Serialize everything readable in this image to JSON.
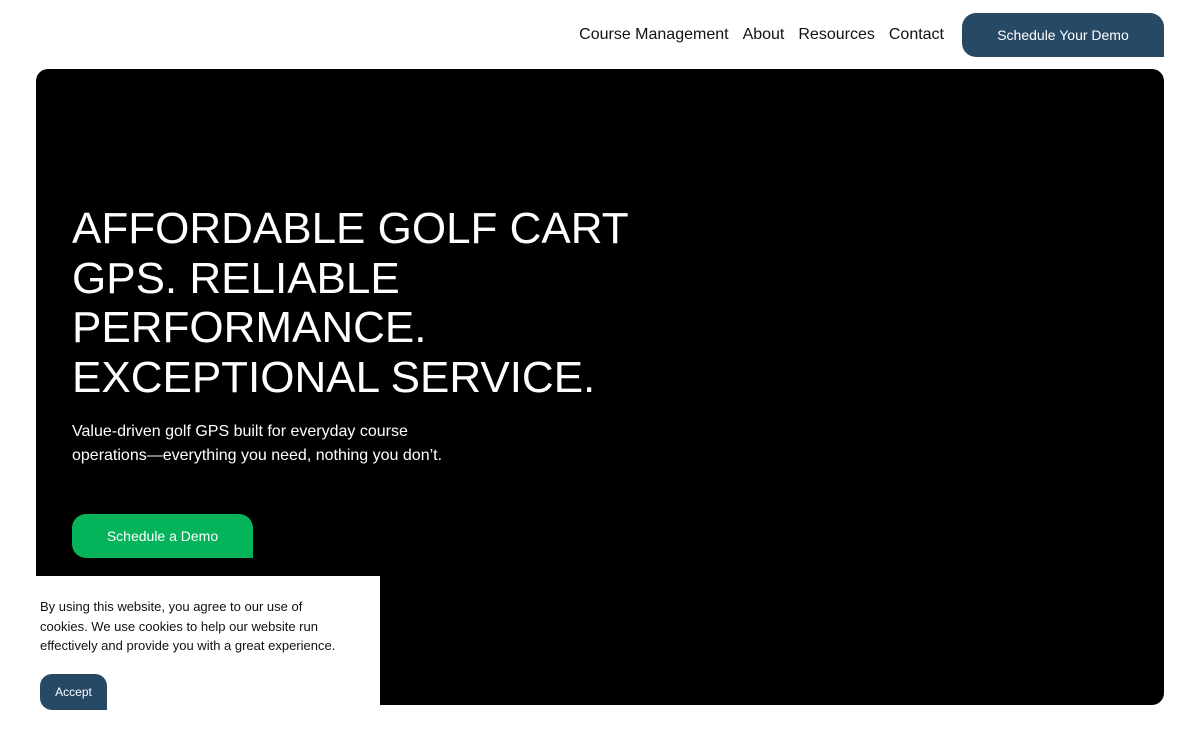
{
  "nav": {
    "links": [
      "Course Management",
      "About",
      "Resources",
      "Contact"
    ],
    "cta_label": "Schedule Your Demo"
  },
  "hero": {
    "title": "AFFORDABLE GOLF CART GPS. RELIABLE PERFORMANCE. EXCEPTIONAL SERVICE.",
    "subtitle": "Value-driven golf GPS built for everyday course operations—everything you need, nothing you don’t.",
    "cta_label": "Schedule a Demo"
  },
  "cookie": {
    "text": "By using this website, you agree to our use of cookies. We use cookies to help our website run effectively and provide you with a great experience.",
    "accept_label": "Accept"
  },
  "colors": {
    "nav_button": "#264966",
    "hero_background": "#000000",
    "hero_cta": "#05b35a"
  }
}
